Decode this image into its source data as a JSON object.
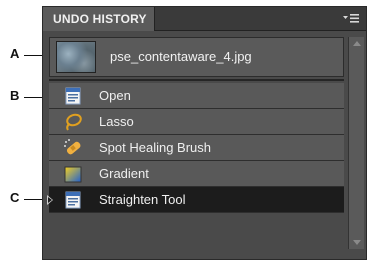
{
  "callouts": {
    "a": "A",
    "b": "B",
    "c": "C"
  },
  "panel": {
    "title": "UNDO HISTORY",
    "menu_icon": "panel-menu-icon"
  },
  "snapshot": {
    "filename": "pse_contentaware_4.jpg"
  },
  "history": [
    {
      "label": "Open",
      "icon": "document-icon"
    },
    {
      "label": "Lasso",
      "icon": "lasso-icon"
    },
    {
      "label": "Spot Healing Brush",
      "icon": "bandage-icon"
    },
    {
      "label": "Gradient",
      "icon": "gradient-icon"
    },
    {
      "label": "Straighten Tool",
      "icon": "document-icon",
      "selected": true
    }
  ],
  "colors": {
    "panel_bg": "#4a4a4a",
    "row_bg": "#595959",
    "selected_row_bg": "#1c1c1c",
    "text": "#efefef"
  }
}
